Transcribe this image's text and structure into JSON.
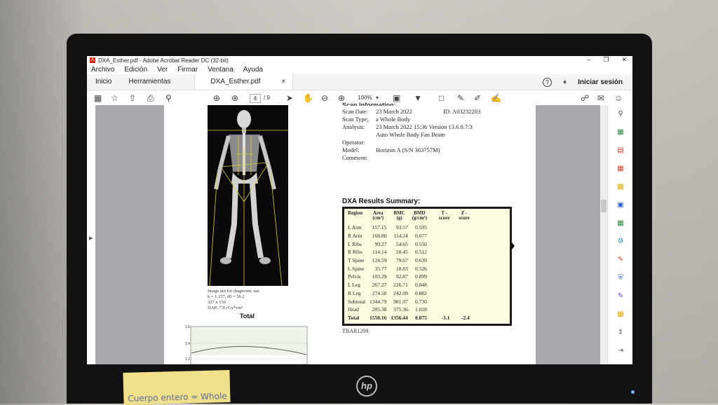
{
  "window": {
    "title": "DXA_Esther.pdf - Adobe Acrobat Reader DC (32-bit)",
    "controls": [
      "–",
      "❐",
      "✕"
    ]
  },
  "menu": [
    "Archivo",
    "Edición",
    "Ver",
    "Firmar",
    "Ventana",
    "Ayuda"
  ],
  "tabs": {
    "home": "Inicio",
    "tools": "Herramientas",
    "document": "DXA_Esther.pdf",
    "close": "×",
    "signin": "Iniciar sesión"
  },
  "toolbar": {
    "current_page": "4",
    "total_pages": "/ 9",
    "zoom": "100%"
  },
  "scan": {
    "title": "Scan Information:",
    "rows": [
      {
        "k": "Scan Date:",
        "v": "23 March 2022",
        "id": "ID:  A03232203"
      },
      {
        "k": "Scan Type:",
        "v": "a Whole Body"
      },
      {
        "k": "Analysis:",
        "v": "23 March 2022 15:36 Version 13.6.0.7:3"
      },
      {
        "k": "",
        "v": "Auto Whole Body Fan Beam"
      },
      {
        "k": "Operator:",
        "v": ""
      },
      {
        "k": "Model:",
        "v": "Horizon A (S/N 303757M)"
      },
      {
        "k": "Comment:",
        "v": ""
      }
    ]
  },
  "image_note": {
    "line1": "Image not for diagnostic use",
    "line2": "k = 1.157, d0 = 56.2",
    "line3": "327 x 150",
    "line4": "DAP: 7.9 cGy*cm²",
    "total": "Total"
  },
  "graph": {
    "y_ticks": [
      "1.6",
      "1.4",
      "1.2"
    ]
  },
  "results": {
    "title": "DXA Results Summary:",
    "headers": [
      {
        "l1": "Region",
        "l2": ""
      },
      {
        "l1": "Area",
        "l2": "(cm²)"
      },
      {
        "l1": "BMC",
        "l2": "(g)"
      },
      {
        "l1": "BMD",
        "l2": "(g/cm²)"
      },
      {
        "l1": "T -",
        "l2": "score"
      },
      {
        "l1": "Z -",
        "l2": "score"
      }
    ],
    "rows": [
      [
        "L Arm",
        "157.15",
        "93.57",
        "0.595",
        "",
        ""
      ],
      [
        "R Arm",
        "168.80",
        "114.24",
        "0.677",
        "",
        ""
      ],
      [
        "L Ribs",
        "99.27",
        "54.65",
        "0.550",
        "",
        ""
      ],
      [
        "R Ribs",
        "114.14",
        "58.45",
        "0.512",
        "",
        ""
      ],
      [
        "T Spine",
        "124.59",
        "79.67",
        "0.639",
        "",
        ""
      ],
      [
        "L Spine",
        "35.77",
        "18.83",
        "0.526",
        "",
        ""
      ],
      [
        "Pelvis",
        "103.29",
        "92.87",
        "0.899",
        "",
        ""
      ],
      [
        "L Leg",
        "267.27",
        "226.71",
        "0.848",
        "",
        ""
      ],
      [
        "R Leg",
        "274.50",
        "242.09",
        "0.882",
        "",
        ""
      ],
      [
        "Subtotal",
        "1344.79",
        "981.07",
        "0.730",
        "",
        ""
      ],
      [
        "Head",
        "205.38",
        "375.36",
        "1.828",
        "",
        ""
      ],
      [
        "Total",
        "1550.16",
        "1356.44",
        "0.875",
        "-3.1",
        "-2.4"
      ]
    ],
    "footer": "TBAR1209"
  },
  "sticky_note": "Cuerpo entero = Whole Body",
  "monitor_brand": "hp"
}
